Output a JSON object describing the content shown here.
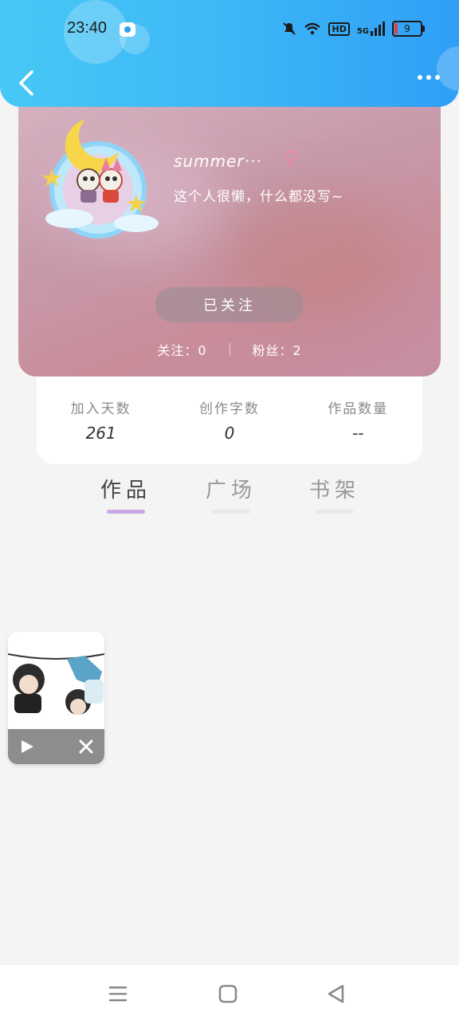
{
  "status_bar": {
    "time": "23:40",
    "network": "5G",
    "hd": "HD",
    "battery": "9"
  },
  "profile": {
    "username": "summer···",
    "gender_symbol": "♀",
    "bio": "这个人很懒，什么都没写~",
    "follow_button": "已关注",
    "following": "关注：0",
    "fans": "粉丝：2"
  },
  "stats": [
    {
      "label": "加入天数",
      "value": "261"
    },
    {
      "label": "创作字数",
      "value": "0"
    },
    {
      "label": "作品数量",
      "value": "--"
    }
  ],
  "tabs": [
    {
      "label": "作品",
      "active": true
    },
    {
      "label": "广场",
      "active": false
    },
    {
      "label": "书架",
      "active": false
    }
  ],
  "colors": {
    "header_start": "#47c8f5",
    "header_end": "#2f9ff6",
    "active_tab_underline": "#c9a8e6",
    "gender_pink": "#e98aa6"
  },
  "icons": {
    "back": "chevron-left-icon",
    "more": "more-dots-icon",
    "play": "play-icon",
    "close": "close-icon",
    "nav_menu": "menu-icon",
    "nav_home": "home-square-icon",
    "nav_back": "back-triangle-icon"
  }
}
